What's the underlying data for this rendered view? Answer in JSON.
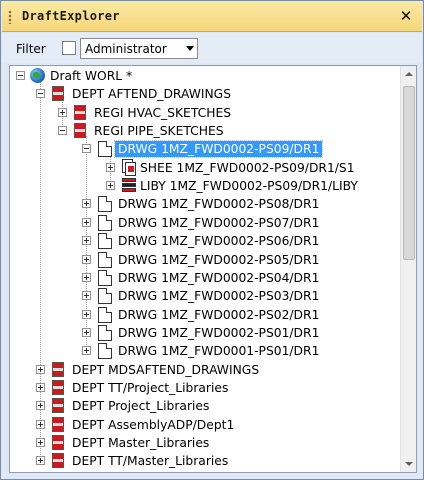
{
  "window": {
    "title": "DraftExplorer",
    "close_glyph": "✕"
  },
  "filter": {
    "label": "Filter",
    "checked": false,
    "selected_value": "Administrator"
  },
  "tree": {
    "rows": [
      {
        "label": "Draft WORL *",
        "icon": "globe-icon",
        "level": 0,
        "expander": "minus"
      },
      {
        "label": "DEPT AFTEND_DRAWINGS",
        "icon": "department-icon",
        "level": 1,
        "expander": "minus"
      },
      {
        "label": "REGI HVAC_SKETCHES",
        "icon": "register-icon",
        "level": 2,
        "expander": "plus"
      },
      {
        "label": "REGI PIPE_SKETCHES",
        "icon": "register-icon",
        "level": 2,
        "expander": "minus"
      },
      {
        "label": "DRWG 1MZ_FWD0002-PS09/DR1",
        "icon": "drawing-icon",
        "level": 3,
        "expander": "minus",
        "selected": true
      },
      {
        "label": "SHEE 1MZ_FWD0002-PS09/DR1/S1",
        "icon": "sheet-icon",
        "level": 4,
        "expander": "plus"
      },
      {
        "label": "LIBY 1MZ_FWD0002-PS09/DR1/LIBY",
        "icon": "library-icon",
        "level": 4,
        "expander": "plus"
      },
      {
        "label": "DRWG 1MZ_FWD0002-PS08/DR1",
        "icon": "drawing-icon",
        "level": 3,
        "expander": "plus"
      },
      {
        "label": "DRWG 1MZ_FWD0002-PS07/DR1",
        "icon": "drawing-icon",
        "level": 3,
        "expander": "plus"
      },
      {
        "label": "DRWG 1MZ_FWD0002-PS06/DR1",
        "icon": "drawing-icon",
        "level": 3,
        "expander": "plus"
      },
      {
        "label": "DRWG 1MZ_FWD0002-PS05/DR1",
        "icon": "drawing-icon",
        "level": 3,
        "expander": "plus"
      },
      {
        "label": "DRWG 1MZ_FWD0002-PS04/DR1",
        "icon": "drawing-icon",
        "level": 3,
        "expander": "plus"
      },
      {
        "label": "DRWG 1MZ_FWD0002-PS03/DR1",
        "icon": "drawing-icon",
        "level": 3,
        "expander": "plus"
      },
      {
        "label": "DRWG 1MZ_FWD0002-PS02/DR1",
        "icon": "drawing-icon",
        "level": 3,
        "expander": "plus"
      },
      {
        "label": "DRWG 1MZ_FWD0002-PS01/DR1",
        "icon": "drawing-icon",
        "level": 3,
        "expander": "plus"
      },
      {
        "label": "DRWG 1MZ_FWD0001-PS01/DR1",
        "icon": "drawing-icon",
        "level": 3,
        "expander": "plus"
      },
      {
        "label": "DEPT MDSAFTEND_DRAWINGS",
        "icon": "department-icon",
        "level": 1,
        "expander": "plus"
      },
      {
        "label": "DEPT TT/Project_Libraries",
        "icon": "department-icon",
        "level": 1,
        "expander": "plus"
      },
      {
        "label": "DEPT Project_Libraries",
        "icon": "department-icon",
        "level": 1,
        "expander": "plus"
      },
      {
        "label": "DEPT AssemblyADP/Dept1",
        "icon": "department-icon",
        "level": 1,
        "expander": "plus"
      },
      {
        "label": "DEPT Master_Libraries",
        "icon": "department-icon",
        "level": 1,
        "expander": "plus"
      },
      {
        "label": "DEPT TT/Master_Libraries",
        "icon": "department-icon",
        "level": 1,
        "expander": "plus"
      }
    ]
  }
}
